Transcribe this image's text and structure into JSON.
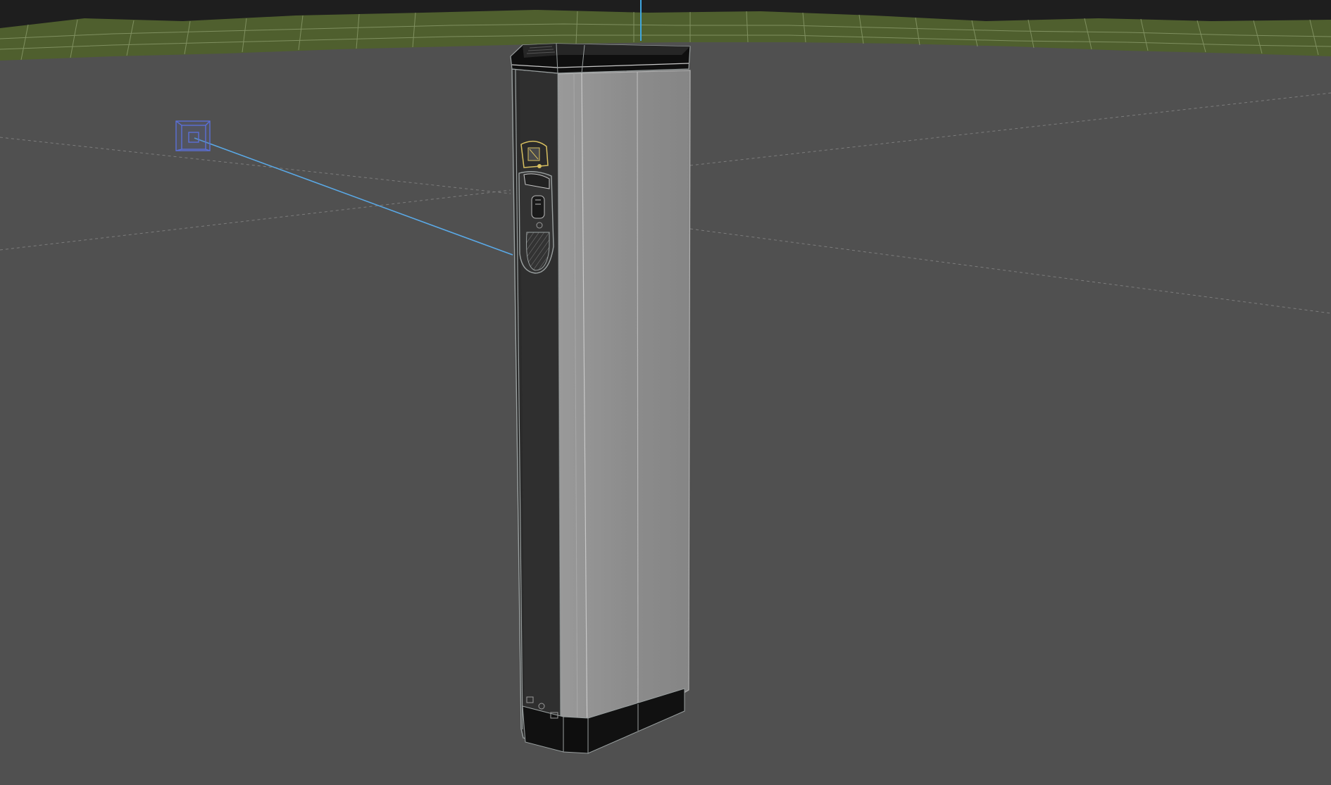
{
  "app": {
    "view": "perspective-viewport"
  },
  "scene": {
    "objects": [
      {
        "name": "ev-charger-pillar",
        "role": "mesh"
      },
      {
        "name": "camera",
        "role": "camera"
      },
      {
        "name": "ground-plane",
        "role": "terrain"
      }
    ]
  },
  "colors": {
    "viewport_background": "#505050",
    "sky_band": "#1e1e1e",
    "terrain": "#4f5f2e",
    "wireframe": "#9aa0a0",
    "pillar_face_front": "#2b2b2b",
    "pillar_face_side": "#8c8c8c",
    "pillar_base": "#111111",
    "camera_gizmo": "#5a6fd6",
    "camera_target_line": "#5aa9e6",
    "world_axis_z": "#3fa7e0",
    "selection_highlight": "#d8c060",
    "grid_guide": "#888888"
  },
  "icons": {
    "camera": "camera-gizmo-icon",
    "axis": "world-axis-icon"
  }
}
